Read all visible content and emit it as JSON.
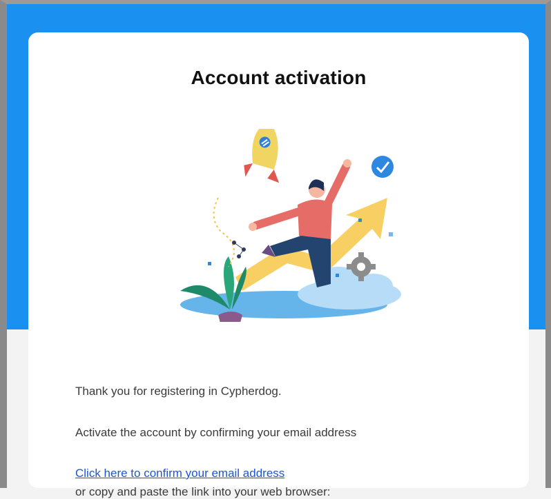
{
  "email": {
    "title": "Account activation",
    "thanks_text": "Thank you for registering in Cypherdog.",
    "instruction_text": "Activate the account by confirming your email address",
    "confirm_link_text": "Click here to confirm your email address",
    "copy_text": "or copy and paste the link into your web browser:"
  },
  "colors": {
    "band": "#1a90f0",
    "card": "#ffffff",
    "link": "#1a55d6"
  },
  "icons": [
    "rocket-icon",
    "checkmark-badge-icon",
    "gear-icon",
    "growth-arrow-icon",
    "plant-icon",
    "cloud-icon"
  ]
}
